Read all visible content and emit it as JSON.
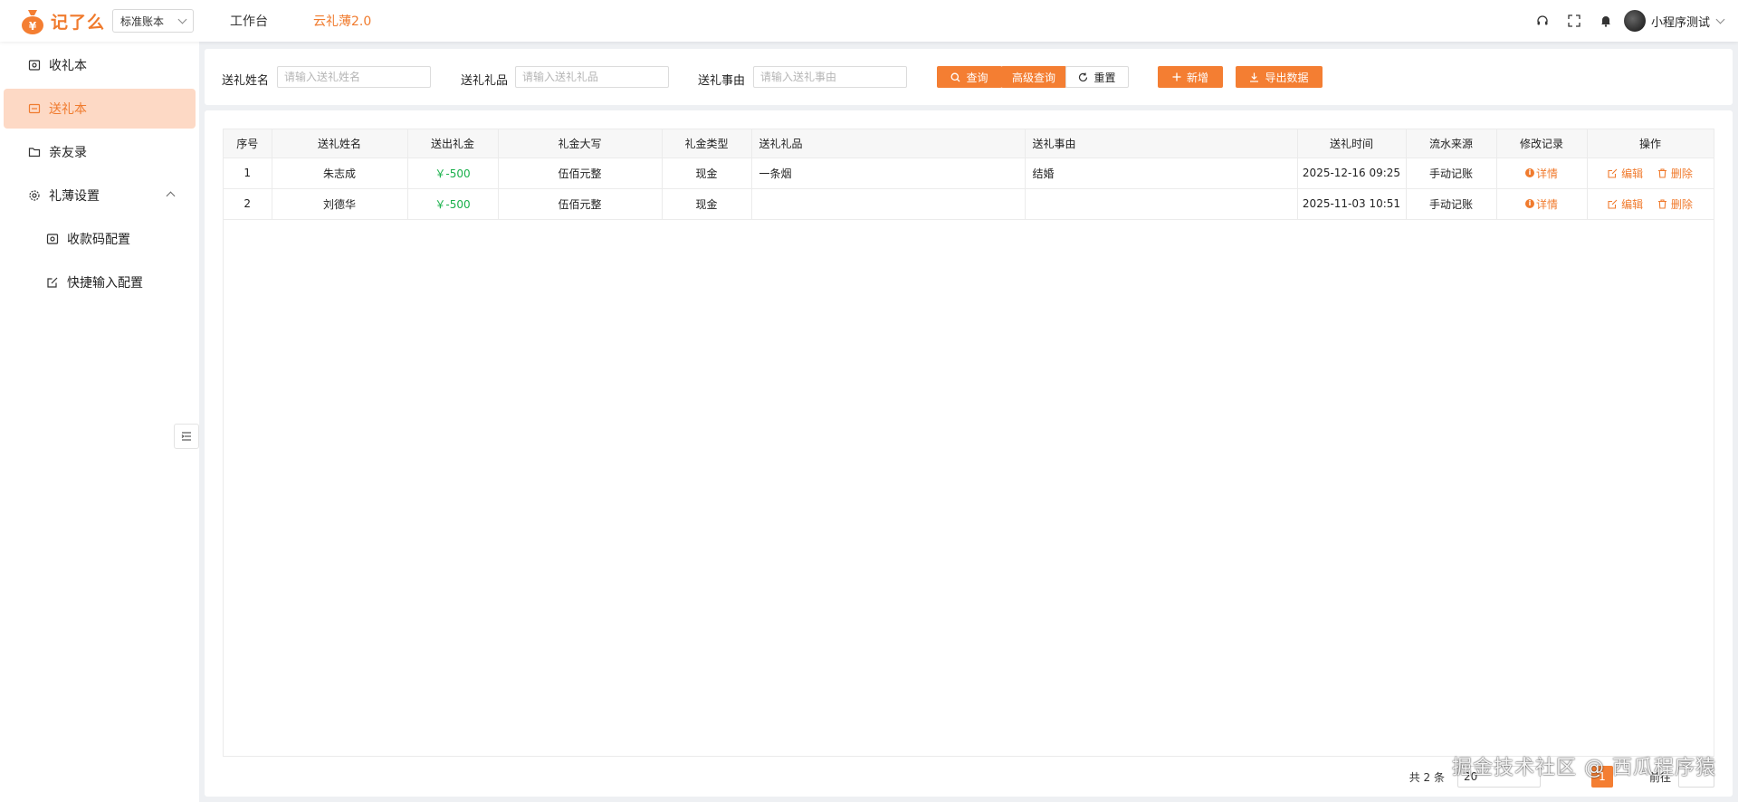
{
  "app": {
    "logo_text": "记了么",
    "book_select": "标准账本",
    "nav_workbench": "工作台",
    "nav_cloud": "云礼薄2.0",
    "user_name": "小程序测试"
  },
  "sidebar": {
    "items": [
      {
        "label": "收礼本",
        "icon": "ledger-icon"
      },
      {
        "label": "送礼本",
        "icon": "gift-book-icon"
      },
      {
        "label": "亲友录",
        "icon": "folder-icon"
      },
      {
        "label": "礼薄设置",
        "icon": "settings-icon"
      },
      {
        "label": "收款码配置",
        "icon": "qrcode-icon"
      },
      {
        "label": "快捷输入配置",
        "icon": "edit-icon"
      }
    ]
  },
  "search": {
    "name_label": "送礼姓名",
    "name_placeholder": "请输入送礼姓名",
    "gift_label": "送礼礼品",
    "gift_placeholder": "请输入送礼礼品",
    "reason_label": "送礼事由",
    "reason_placeholder": "请输入送礼事由",
    "query": "查询",
    "advanced": "高级查询",
    "reset": "重置",
    "add": "新增",
    "export": "导出数据"
  },
  "table": {
    "headers": [
      "序号",
      "送礼姓名",
      "送出礼金",
      "礼金大写",
      "礼金类型",
      "送礼礼品",
      "送礼事由",
      "送礼时间",
      "流水来源",
      "修改记录",
      "操作"
    ],
    "rows": [
      {
        "idx": "1",
        "name": "朱志成",
        "amount": "￥-500",
        "upper": "伍佰元整",
        "type": "现金",
        "gift": "一条烟",
        "reason": "结婚",
        "time": "2025-12-16 09:25",
        "source": "手动记账",
        "record": "详情"
      },
      {
        "idx": "2",
        "name": "刘德华",
        "amount": "￥-500",
        "upper": "伍佰元整",
        "type": "现金",
        "gift": "",
        "reason": "",
        "time": "2025-11-03 10:51",
        "source": "手动记账",
        "record": "详情"
      }
    ],
    "edit_label": "编辑",
    "delete_label": "删除"
  },
  "pagination": {
    "total": "共 2 条",
    "page_size": "20",
    "current_page": "1",
    "goto_label": "前往"
  },
  "watermark": "掘金技术社区 @ 西瓜程序猿",
  "colors": {
    "accent": "#f47e32",
    "active_bg": "#fdd9c5",
    "money": "#19b04b"
  }
}
